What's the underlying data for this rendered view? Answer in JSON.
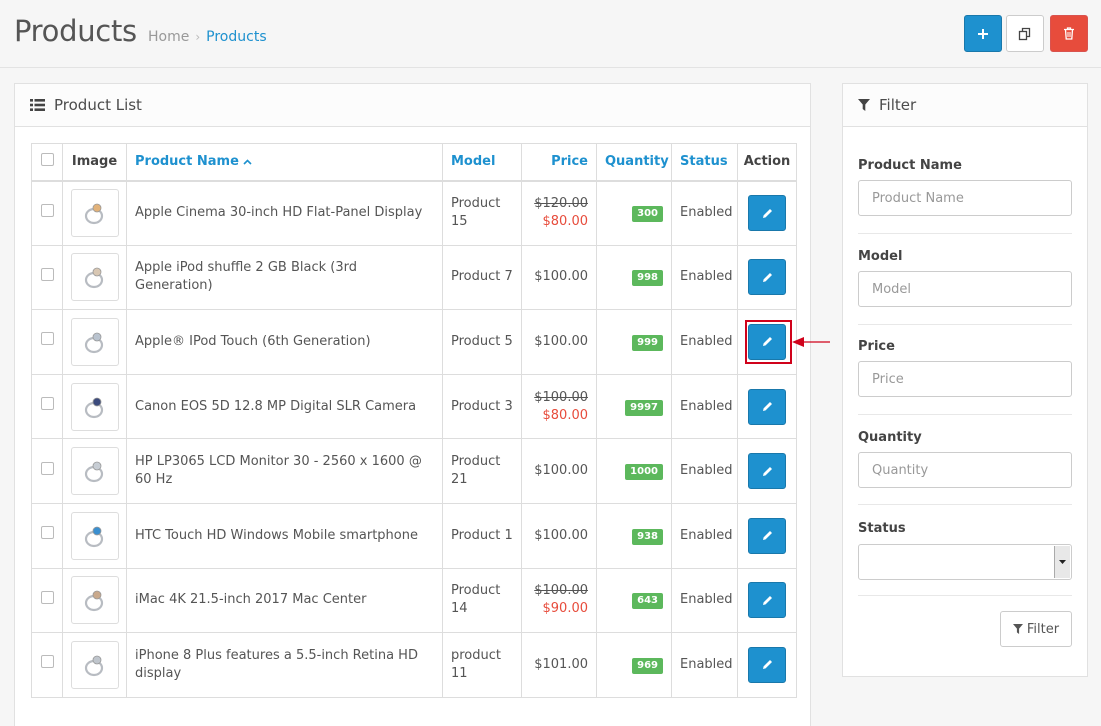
{
  "header": {
    "title": "Products",
    "breadcrumb": [
      {
        "label": "Home",
        "active": false
      },
      {
        "label": "Products",
        "active": true
      }
    ]
  },
  "list": {
    "heading": "Product List",
    "columns": {
      "image": "Image",
      "name": "Product Name",
      "model": "Model",
      "price": "Price",
      "quantity": "Quantity",
      "status": "Status",
      "action": "Action"
    },
    "rows": [
      {
        "name": "Apple Cinema 30-inch HD Flat-Panel Display",
        "model": "Product 15",
        "price_old": "$120.00",
        "price": "$80.00",
        "quantity": "300",
        "status": "Enabled"
      },
      {
        "name": "Apple iPod shuffle 2 GB Black (3rd Generation)",
        "model": "Product 7",
        "price_old": "",
        "price": "$100.00",
        "quantity": "998",
        "status": "Enabled"
      },
      {
        "name": "Apple® IPod Touch (6th Generation)",
        "model": "Product 5",
        "price_old": "",
        "price": "$100.00",
        "quantity": "999",
        "status": "Enabled"
      },
      {
        "name": "Canon EOS 5D 12.8 MP Digital SLR Camera",
        "model": "Product 3",
        "price_old": "$100.00",
        "price": "$80.00",
        "quantity": "9997",
        "status": "Enabled"
      },
      {
        "name": "HP LP3065 LCD Monitor 30 - 2560 x 1600 @ 60 Hz",
        "model": "Product 21",
        "price_old": "",
        "price": "$100.00",
        "quantity": "1000",
        "status": "Enabled"
      },
      {
        "name": "HTC Touch HD Windows Mobile smartphone",
        "model": "Product 1",
        "price_old": "",
        "price": "$100.00",
        "quantity": "938",
        "status": "Enabled"
      },
      {
        "name": "iMac 4K 21.5-inch 2017 Mac Center",
        "model": "Product 14",
        "price_old": "$100.00",
        "price": "$90.00",
        "quantity": "643",
        "status": "Enabled"
      },
      {
        "name": "iPhone 8 Plus features a 5.5-inch Retina HD display",
        "model": "product 11",
        "price_old": "",
        "price": "$101.00",
        "quantity": "969",
        "status": "Enabled"
      }
    ]
  },
  "filter": {
    "heading": "Filter",
    "fields": [
      {
        "label": "Product Name",
        "placeholder": "Product Name"
      },
      {
        "label": "Model",
        "placeholder": "Model"
      },
      {
        "label": "Price",
        "placeholder": "Price"
      },
      {
        "label": "Quantity",
        "placeholder": "Quantity"
      }
    ],
    "status_label": "Status",
    "status_value": "",
    "button_label": "Filter"
  },
  "colors": {
    "primary": "#1e91cf",
    "danger": "#e74c3c",
    "success_badge": "#5cb85c",
    "sale_price": "#e74c3c",
    "highlight": "#d0021b"
  }
}
